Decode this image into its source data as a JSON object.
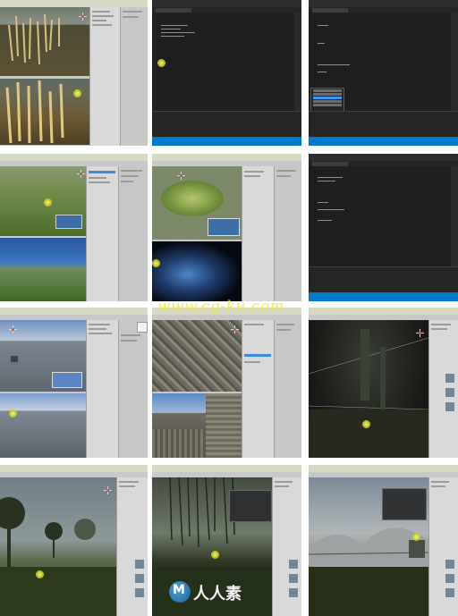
{
  "screenshots": [
    {
      "id": "r1c1",
      "kind": "editor",
      "title": "",
      "top_scene": "wheat field",
      "bottom_scene": "wheat field closeup"
    },
    {
      "id": "r1c2",
      "kind": "code",
      "title": ""
    },
    {
      "id": "r1c3",
      "kind": "code",
      "title": ""
    },
    {
      "id": "r2c1",
      "kind": "editor",
      "title": "",
      "top_scene": "terrain with pond",
      "bottom_scene": "grass plain horizon"
    },
    {
      "id": "r2c2",
      "kind": "editor",
      "title": "",
      "top_scene": "island terrain",
      "bottom_scene": "night glow"
    },
    {
      "id": "r2c3",
      "kind": "code",
      "title": ""
    },
    {
      "id": "r3c1",
      "kind": "editor",
      "title": "",
      "top_scene": "sky box",
      "bottom_scene": "sky box game view"
    },
    {
      "id": "r3c2",
      "kind": "editor",
      "title": "",
      "top_scene": "stone maze top",
      "bottom_scene": "stone maze corridor"
    },
    {
      "id": "r3c3",
      "kind": "editor",
      "title": "",
      "top_scene": "dark forest",
      "bottom_scene": ""
    },
    {
      "id": "r4c1",
      "kind": "editor",
      "title": "",
      "top_scene": "foggy trees",
      "bottom_scene": ""
    },
    {
      "id": "r4c2",
      "kind": "editor",
      "title": "",
      "top_scene": "willow tree",
      "bottom_scene": ""
    },
    {
      "id": "r4c3",
      "kind": "editor",
      "title": "",
      "top_scene": "foggy hills",
      "bottom_scene": ""
    }
  ],
  "watermark": {
    "text": "www.cg-ku.com"
  },
  "logo": {
    "text": "人人素",
    "icon": "m-logo-icon"
  },
  "colors": {
    "editor_gray": "#c8c8c8",
    "code_bg": "#1e1e1e",
    "status_blue": "#007acc",
    "title_green": "#d6d9c4",
    "cursor_yellow": "#e8e84a"
  }
}
